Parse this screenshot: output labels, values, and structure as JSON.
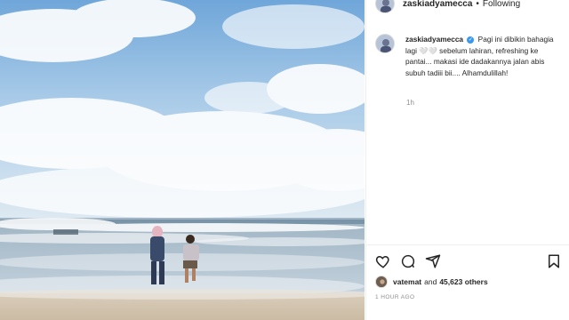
{
  "post": {
    "username": "zaskiadyamecca",
    "dot": "•",
    "follow_label": "Following",
    "caption": "Pagi ini dibikin bahagia lagi 🤍🤍 sebelum lahiran, refreshing ke pantai... makasi ide dadakannya jalan abis subuh tadiii bii.... Alhamdulillah!",
    "time_short": "1h",
    "liked_by_user": "vatemat",
    "liked_by_joiner": "and",
    "likes_count": "45,623 others",
    "time_ago": "1 HOUR AGO"
  },
  "icons": {
    "like": "heart-icon",
    "comment": "comment-icon",
    "share": "send-icon",
    "save": "bookmark-icon",
    "verified": "verified-badge-icon"
  },
  "colors": {
    "verified_blue": "#3897f0",
    "muted_text": "#8e8e8e",
    "text": "#262626"
  }
}
